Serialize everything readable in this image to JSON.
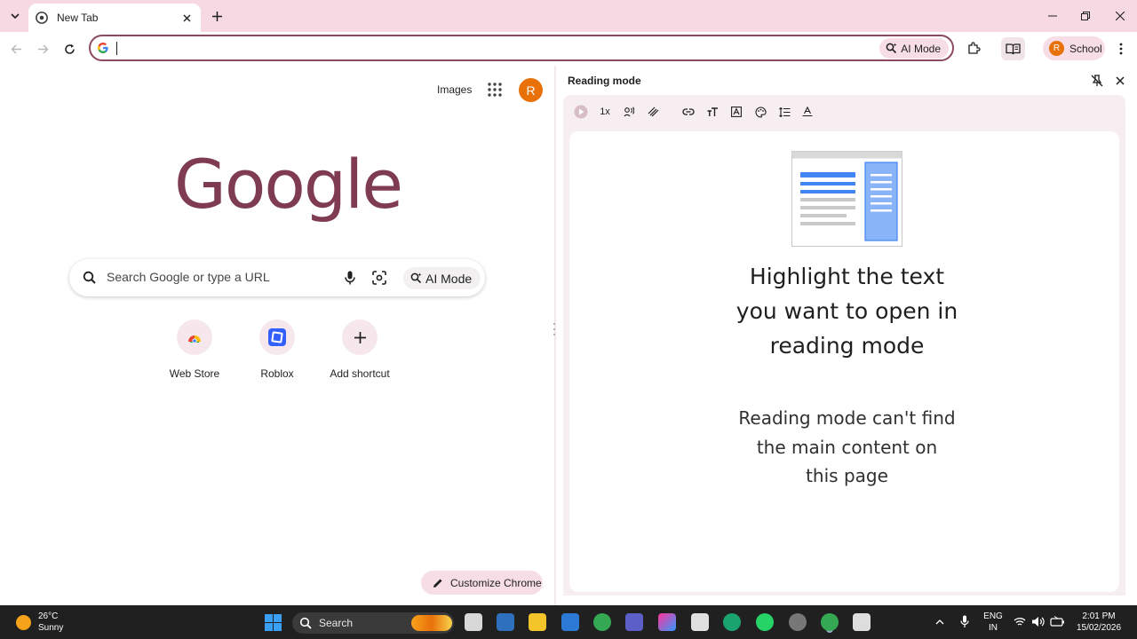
{
  "browser": {
    "tab": {
      "title": "New Tab"
    },
    "omnibox": {
      "value": "",
      "ai_mode_label": "AI Mode"
    },
    "profile": {
      "initial": "R",
      "label": "School"
    }
  },
  "ntp": {
    "images_link": "Images",
    "avatar_initial": "R",
    "logo_text": "Google",
    "search_placeholder": "Search Google or type a URL",
    "ai_mode_label": "AI Mode",
    "shortcuts": [
      {
        "label": "Web Store",
        "icon": "web-store-icon"
      },
      {
        "label": "Roblox",
        "icon": "roblox-icon"
      },
      {
        "label": "Add shortcut",
        "icon": "plus-icon"
      }
    ],
    "customize_label": "Customize Chrome"
  },
  "reading_mode": {
    "title": "Reading mode",
    "speed_label": "1x",
    "heading": "Highlight the text you want to open in reading mode",
    "message": "Reading mode can't find the main content on this page"
  },
  "taskbar": {
    "weather": {
      "temp": "26°C",
      "condition": "Sunny"
    },
    "search_label": "Search",
    "language": {
      "line1": "ENG",
      "line2": "IN"
    },
    "clock": {
      "time": "2:01 PM",
      "date": "15/02/2026"
    }
  },
  "colors": {
    "accent": "#7e3b51",
    "tabstrip": "#f7d9e3",
    "avatar": "#e8710a"
  }
}
